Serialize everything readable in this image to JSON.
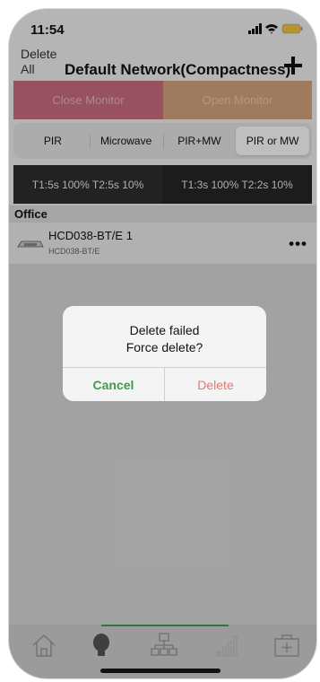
{
  "status": {
    "time": "11:54",
    "battery_color": "#f3c542"
  },
  "nav": {
    "delete_all": "Delete All",
    "title": "Default Network(Compactness)"
  },
  "monitor": {
    "close_label": "Close Monitor",
    "open_label": "Open Monitor"
  },
  "sensor_modes": {
    "items": [
      "PIR",
      "Microwave",
      "PIR+MW",
      "PIR or MW"
    ],
    "selected": "PIR or MW"
  },
  "timers": {
    "left": "T1:5s 100% T2:5s 10%",
    "right": "T1:3s 100% T2:2s 10%"
  },
  "section": {
    "title": "Office"
  },
  "device": {
    "name": "HCD038-BT/E 1",
    "model": "HCD038-BT/E",
    "more": "•••"
  },
  "dialog": {
    "line1": "Delete failed",
    "line2": "Force delete?",
    "cancel": "Cancel",
    "delete": "Delete"
  },
  "tabs": [
    "home-icon",
    "bulb-icon",
    "network-icon",
    "signal-icon",
    "firstaid-icon"
  ],
  "colors": {
    "accent_green": "#3f9b52",
    "close_monitor": "#cb6d80",
    "open_monitor": "#d3a57f",
    "delete_red": "#e07a73"
  }
}
